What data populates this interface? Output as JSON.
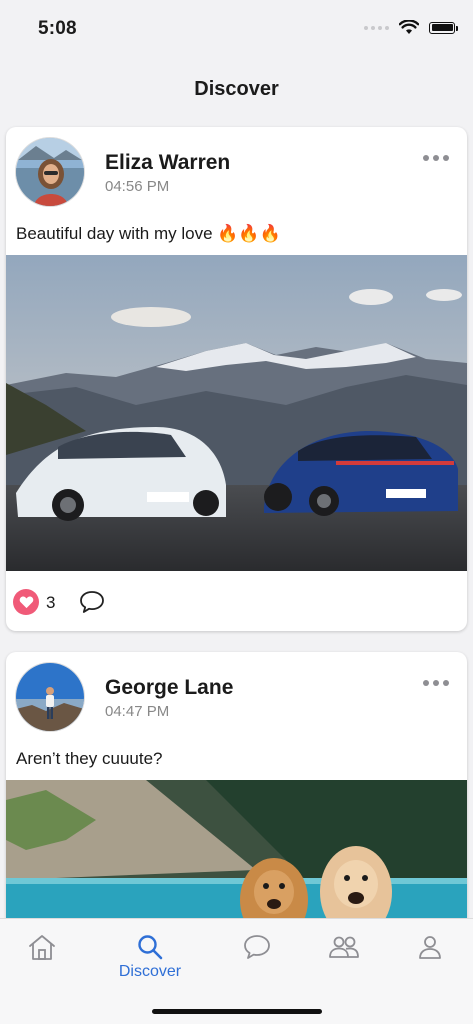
{
  "status_bar": {
    "time": "5:08"
  },
  "header": {
    "title": "Discover"
  },
  "posts": [
    {
      "author": "Eliza Warren",
      "time": "04:56 PM",
      "caption": "Beautiful day with my love 🔥🔥🔥",
      "likes": "3"
    },
    {
      "author": "George Lane",
      "time": "04:47 PM",
      "caption": "Aren’t they cuuute?"
    }
  ],
  "tabbar": {
    "items": [
      {
        "icon": "home-icon",
        "label": ""
      },
      {
        "icon": "search-icon",
        "label": "Discover",
        "active": true
      },
      {
        "icon": "chat-bubble-icon",
        "label": ""
      },
      {
        "icon": "people-icon",
        "label": ""
      },
      {
        "icon": "person-icon",
        "label": ""
      }
    ]
  },
  "colors": {
    "accent": "#2f6fd6",
    "like": "#f05a78"
  }
}
